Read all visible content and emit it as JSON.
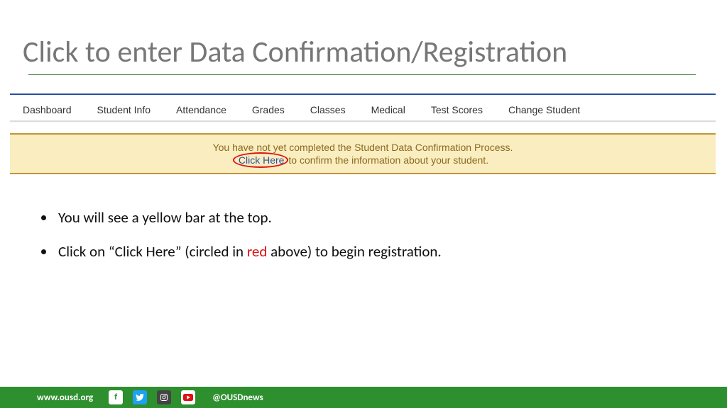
{
  "title": "Click to enter Data Confirmation/Registration",
  "nav": {
    "items": [
      "Dashboard",
      "Student Info",
      "Attendance",
      "Grades",
      "Classes",
      "Medical",
      "Test Scores",
      "Change Student"
    ]
  },
  "banner": {
    "line1": "You have not yet completed the Student Data Confirmation Process.",
    "click_label": "Click Here",
    "line2_rest": " to confirm the information about your student."
  },
  "bullets": {
    "b1": "You will see a yellow bar at the top.",
    "b2_a": "Click on “Click Here” (circled in ",
    "b2_red": "red",
    "b2_b": " above) to begin registration."
  },
  "footer": {
    "url": "www.ousd.org",
    "handle": "@OUSDnews",
    "icons": {
      "fb": "f",
      "tw": "",
      "ig": "",
      "yt": ""
    }
  }
}
